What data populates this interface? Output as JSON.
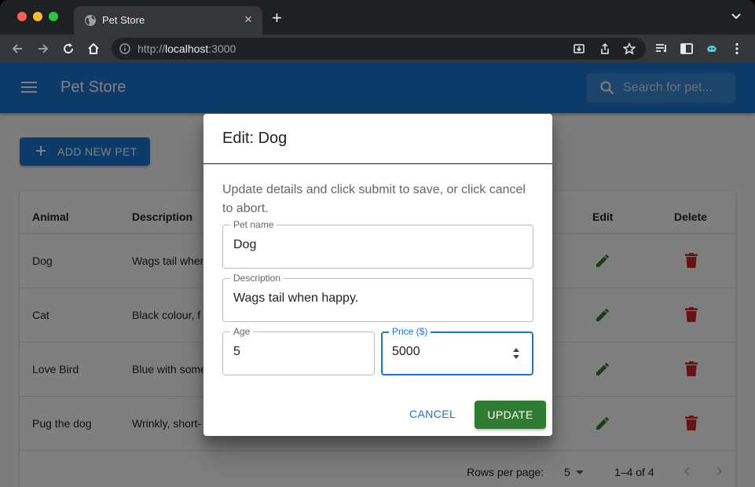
{
  "browser": {
    "tab_title": "Pet Store",
    "url_prefix": "http://",
    "url_host": "localhost",
    "url_suffix": ":3000"
  },
  "app": {
    "title": "Pet Store",
    "search_placeholder": "Search for pet...",
    "add_button": "ADD NEW PET",
    "primary_color": "#1976d2",
    "edit_color": "#2e7d32",
    "delete_color": "#c62828"
  },
  "table": {
    "headers": {
      "animal": "Animal",
      "description": "Description",
      "edit": "Edit",
      "delete": "Delete"
    },
    "rows": [
      {
        "animal": "Dog",
        "description": "Wags tail when"
      },
      {
        "animal": "Cat",
        "description": "Black colour, f"
      },
      {
        "animal": "Love Bird",
        "description": "Blue with some"
      },
      {
        "animal": "Pug the dog",
        "description": "Wrinkly, short-"
      }
    ],
    "pagination": {
      "rows_label": "Rows per page:",
      "rows_value": "5",
      "range": "1–4 of 4"
    }
  },
  "dialog": {
    "title": "Edit: Dog",
    "description": "Update details and click submit to save, or click cancel to abort.",
    "fields": {
      "pet_name": {
        "label": "Pet name",
        "value": "Dog"
      },
      "description": {
        "label": "Description",
        "value": "Wags tail when happy."
      },
      "age": {
        "label": "Age",
        "value": "5"
      },
      "price": {
        "label": "Price ($)",
        "value": "5000"
      }
    },
    "cancel": "CANCEL",
    "update": "UPDATE"
  }
}
